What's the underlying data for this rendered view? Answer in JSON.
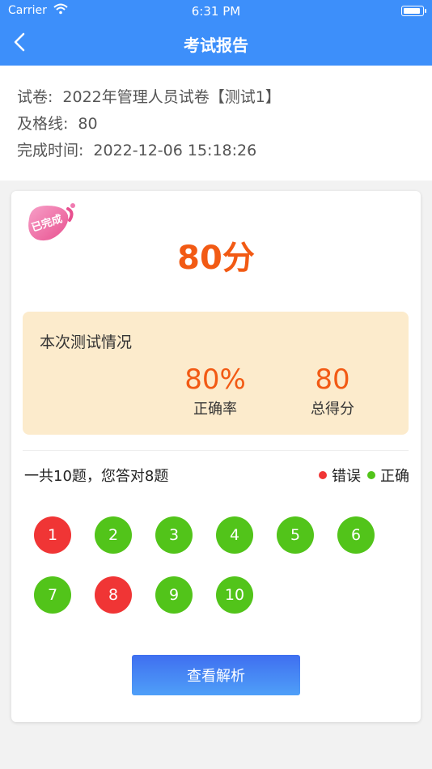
{
  "status_bar": {
    "carrier": "Carrier",
    "time": "6:31 PM"
  },
  "nav": {
    "title": "考试报告"
  },
  "exam": {
    "paper_label": "试卷:",
    "paper_value": "2022年管理人员试卷【测试1】",
    "pass_label": "及格线:",
    "pass_value": "80",
    "time_label": "完成时间:",
    "time_value": "2022-12-06 15:18:26"
  },
  "result": {
    "stamp_text": "已完成",
    "score": "80分",
    "summary_title": "本次测试情况",
    "accuracy": "80%",
    "accuracy_label": "正确率",
    "total_score": "80",
    "total_label": "总得分",
    "count_text": "一共10题，您答对8题",
    "legend": {
      "wrong": "错误",
      "correct": "正确"
    }
  },
  "questions": [
    {
      "num": "1",
      "status": "wrong"
    },
    {
      "num": "2",
      "status": "correct"
    },
    {
      "num": "3",
      "status": "correct"
    },
    {
      "num": "4",
      "status": "correct"
    },
    {
      "num": "5",
      "status": "correct"
    },
    {
      "num": "6",
      "status": "correct"
    },
    {
      "num": "7",
      "status": "correct"
    },
    {
      "num": "8",
      "status": "wrong"
    },
    {
      "num": "9",
      "status": "correct"
    },
    {
      "num": "10",
      "status": "correct"
    }
  ],
  "actions": {
    "view_analysis": "查看解析"
  },
  "colors": {
    "primary": "#3d8ffa",
    "accent": "#f25a14",
    "wrong": "#f03535",
    "correct": "#52c41a",
    "summary_bg": "#fcebcc"
  }
}
